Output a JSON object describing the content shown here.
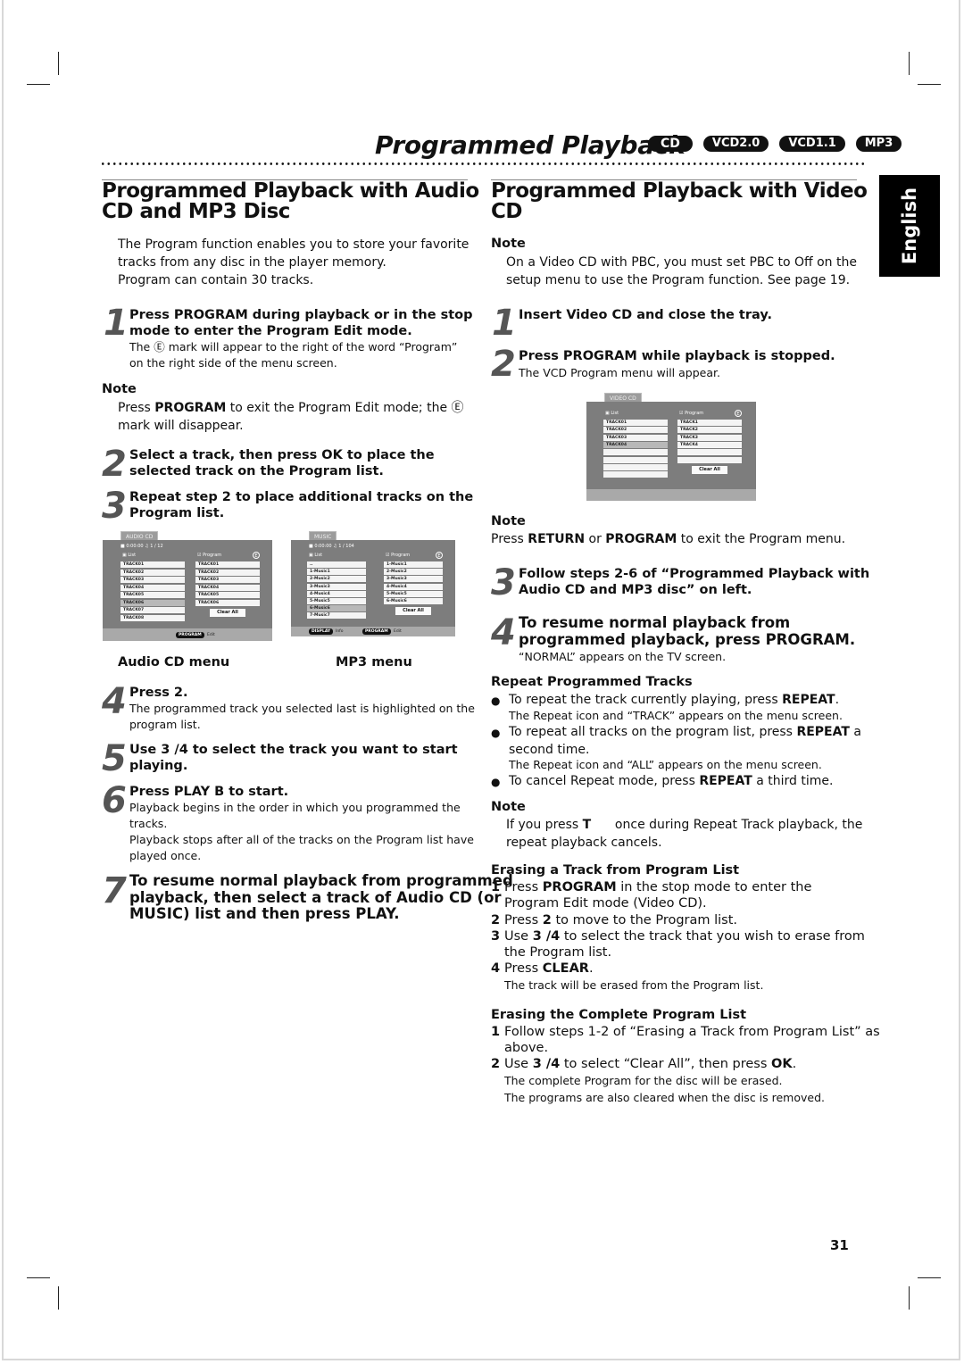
{
  "header": {
    "title": "Programmed Playback",
    "badges": [
      "CD",
      "VCD2.0",
      "VCD1.1",
      "MP3"
    ]
  },
  "language_tab": "English",
  "page_number": "31",
  "left": {
    "heading": [
      "Programmed Playback with Audio",
      "CD and MP3 Disc"
    ],
    "intro": [
      "The Program function enables you to store your favorite",
      "tracks from any disc in the player memory.",
      "Program can contain 30 tracks."
    ],
    "step1": {
      "num": "1",
      "title": [
        "Press PROGRAM during playback or in the stop",
        "mode to enter the Program Edit mode."
      ],
      "desc": [
        "The Ⓔ  mark will appear to the right of the word “Program”",
        "on the right side of the menu screen."
      ]
    },
    "note1": {
      "label": "Note",
      "pre": "Press ",
      "bold": "PROGRAM",
      "post": " to exit the Program Edit mode; the Ⓔ",
      "line2": "mark will disappear."
    },
    "step2": {
      "num": "2",
      "title": [
        "Select a track, then press OK to place the",
        "selected track on the Program list."
      ]
    },
    "step3": {
      "num": "3",
      "title": [
        "Repeat step 2 to place additional tracks on the",
        "Program list."
      ]
    },
    "audio_menu": {
      "tab": "AUDIO CD",
      "time": "0:00:00",
      "counter": "1 / 12",
      "list_label": "List",
      "program_label": "Program",
      "list": [
        "TRACK01",
        "TRACK02",
        "TRACK03",
        "TRACK04",
        "TRACK05",
        "TRACK06",
        "TRACK07",
        "TRACK08"
      ],
      "highlight_index": 5,
      "program": [
        "TRACK01",
        "TRACK02",
        "TRACK03",
        "TRACK04",
        "TRACK05",
        "TRACK06"
      ],
      "clear_all": "Clear All",
      "footer": [
        {
          "key": "PROGRAM",
          "label": "Edit"
        }
      ],
      "caption": "Audio CD menu"
    },
    "mp3_menu": {
      "tab": "MUSIC",
      "time": "0:00:00",
      "counter": "1 / 104",
      "list_label": "List",
      "program_label": "Program",
      "list": [
        "..",
        "1-Music1",
        "2-Music2",
        "3-Music3",
        "4-Music4",
        "5-Music5",
        "6-Music6",
        "7-Music7"
      ],
      "highlight_index": 6,
      "program": [
        "1-Music1",
        "2-Music2",
        "3-Music3",
        "4-Music4",
        "5-Music5",
        "6-Music6"
      ],
      "clear_all": "Clear All",
      "footer": [
        {
          "key": "DISPLAY",
          "label": "Info"
        },
        {
          "key": "PROGRAM",
          "label": "Edit"
        }
      ],
      "caption": "MP3 menu"
    },
    "step4": {
      "num": "4",
      "title": "Press 2.",
      "desc": [
        "The programmed track you selected last is highlighted on the",
        "program list."
      ]
    },
    "step5": {
      "num": "5",
      "title": [
        "Use 3 /4  to select the track you want to start",
        "playing."
      ]
    },
    "step6": {
      "num": "6",
      "title": "Press PLAY B  to start.",
      "desc": [
        "Playback begins in the order in which you programmed the",
        "tracks.",
        "Playback stops after all of the tracks on the Program list have",
        "played once."
      ]
    },
    "step7": {
      "num": "7",
      "title": [
        "To resume normal playback from programmed",
        "playback, then select a track of Audio CD (or",
        "MUSIC) list and then press PLAY."
      ]
    }
  },
  "right": {
    "heading": [
      "Programmed Playback with Video",
      "CD"
    ],
    "note1": {
      "label": "Note",
      "lines": [
        "On a Video CD with PBC, you must set PBC to Off on the",
        "setup menu to use the Program function. See page 19."
      ]
    },
    "step1": {
      "num": "1",
      "title": "Insert Video CD and close the tray."
    },
    "step2": {
      "num": "2",
      "title": "Press PROGRAM while playback is stopped.",
      "desc": "The VCD Program menu will appear."
    },
    "vcd_menu": {
      "tab": "VIDEO CD",
      "list_label": "List",
      "program_label": "Program",
      "list": [
        "TRACK01",
        "TRACK02",
        "TRACK03",
        "TRACK04",
        "",
        "",
        "",
        ""
      ],
      "highlight_index": 3,
      "program": [
        "TRACK1",
        "TRACK2",
        "TRACK3",
        "TRACK4",
        "",
        ""
      ],
      "clear_all": "Clear All"
    },
    "note2": {
      "label": "Note",
      "pre": "Press ",
      "b1": "RETURN",
      "mid": " or ",
      "b2": "PROGRAM",
      "post": " to exit the Program menu."
    },
    "step3": {
      "num": "3",
      "title": [
        "Follow steps 2-6 of “Programmed Playback with",
        "Audio CD and MP3 disc” on left."
      ]
    },
    "step4": {
      "num": "4",
      "title": [
        "To resume normal playback from",
        "programmed playback, press PROGRAM."
      ],
      "desc": "“NORMAL” appears on the TV screen."
    },
    "repeat": {
      "heading": "Repeat Programmed Tracks",
      "b1": {
        "pre": "To repeat the track currently playing, press ",
        "bold": "REPEAT",
        "post": ".",
        "sub": "The Repeat icon and “TRACK” appears on the menu screen."
      },
      "b2": {
        "pre": "To repeat all tracks on the program list, press ",
        "bold": "REPEAT",
        "post": " a",
        "line2": "second time.",
        "sub": "The Repeat icon and “ALL” appears on the menu screen."
      },
      "b3": {
        "pre": "To cancel Repeat mode, press ",
        "bold": "REPEAT",
        "post": " a third time."
      }
    },
    "note3": {
      "label": "Note",
      "pre": "If you press ",
      "bold": "T",
      "post": "      once during Repeat Track playback, the",
      "line2": "repeat playback cancels."
    },
    "erase_track": {
      "heading": "Erasing a Track from Program List",
      "items": [
        {
          "n": "1",
          "pre": "Press ",
          "bold": "PROGRAM",
          "post": " in the stop mode to enter the",
          "line2": "Program Edit  mode (Video CD)."
        },
        {
          "n": "2",
          "pre": "Press ",
          "bold": "2",
          "post": "  to move to the Program list."
        },
        {
          "n": "3",
          "pre": "Use ",
          "bold": "3 /4",
          "post": "  to select the track that you wish to erase from",
          "line2": "the Program list."
        },
        {
          "n": "4",
          "pre": "Press ",
          "bold": "CLEAR",
          "post": ".",
          "sub": "The track will be erased from the Program list."
        }
      ]
    },
    "erase_all": {
      "heading": "Erasing the Complete Program List",
      "items": [
        {
          "n": "1",
          "pre": "Follow steps 1-2 of “Erasing a Track from Program List” as",
          "line2": "above."
        },
        {
          "n": "2",
          "pre": "Use ",
          "bold": "3 /4",
          "post": "  to select “Clear All”, then press ",
          "bold2": "OK",
          "post2": ".",
          "sub": [
            "The complete Program for the disc will be erased.",
            "The programs are also cleared when the disc is removed."
          ]
        }
      ]
    }
  }
}
